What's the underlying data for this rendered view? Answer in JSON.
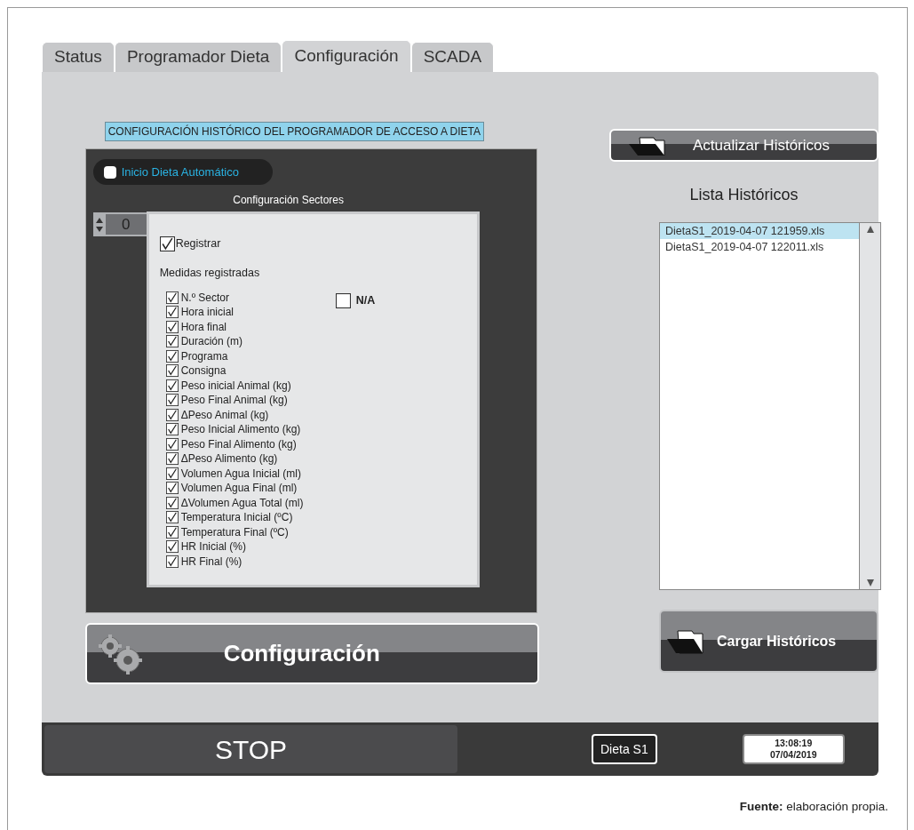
{
  "tabs": [
    {
      "label": "Status",
      "selected": false
    },
    {
      "label": "Programador Dieta",
      "selected": false
    },
    {
      "label": "Configuración",
      "selected": true
    },
    {
      "label": "SCADA",
      "selected": false
    }
  ],
  "section_title": "CONFIGURACIÓN HISTÓRICO DEL PROGRAMADOR DE ACCESO A DIETA",
  "auto_start": {
    "label": "Inicio Dieta Automático",
    "checked": false
  },
  "sectors": {
    "label": "Configuración Sectores",
    "value": "0"
  },
  "registrar": {
    "label": "Registrar",
    "checked": true
  },
  "measures": {
    "title": "Medidas registradas",
    "items": [
      {
        "label": "N.º Sector",
        "checked": true
      },
      {
        "label": "Hora inicial",
        "checked": true
      },
      {
        "label": "Hora final",
        "checked": true
      },
      {
        "label": "Duración (m)",
        "checked": true
      },
      {
        "label": "Programa",
        "checked": true
      },
      {
        "label": "Consigna",
        "checked": true
      },
      {
        "label": "Peso inicial Animal (kg)",
        "checked": true
      },
      {
        "label": "Peso Final Animal (kg)",
        "checked": true
      },
      {
        "label": "ΔPeso Animal (kg)",
        "checked": true
      },
      {
        "label": "Peso Inicial Alimento (kg)",
        "checked": true
      },
      {
        "label": "Peso Final Alimento (kg)",
        "checked": true
      },
      {
        "label": "ΔPeso Alimento (kg)",
        "checked": true
      },
      {
        "label": "Volumen Agua Inicial (ml)",
        "checked": true
      },
      {
        "label": "Volumen Agua Final (ml)",
        "checked": true
      },
      {
        "label": "ΔVolumen Agua Total (ml)",
        "checked": true
      },
      {
        "label": "Temperatura Inicial (ºC)",
        "checked": true
      },
      {
        "label": "Temperatura Final (ºC)",
        "checked": true
      },
      {
        "label": "HR Inicial (%)",
        "checked": true
      },
      {
        "label": "HR Final (%)",
        "checked": true
      }
    ]
  },
  "na": {
    "label": "N/A",
    "checked": false
  },
  "config_button": "Configuración",
  "update_button": "Actualizar Históricos",
  "history": {
    "title": "Lista Históricos",
    "items": [
      {
        "label": "DietaS1_2019-04-07 121959.xls",
        "selected": true
      },
      {
        "label": "DietaS1_2019-04-07 122011.xls",
        "selected": false
      }
    ]
  },
  "load_button": "Cargar Históricos",
  "status_bar": {
    "state": "STOP",
    "diet": "Dieta S1",
    "time": "13:08:19",
    "date": "07/04/2019"
  },
  "caption": "**Fuente:** elaboración propia."
}
